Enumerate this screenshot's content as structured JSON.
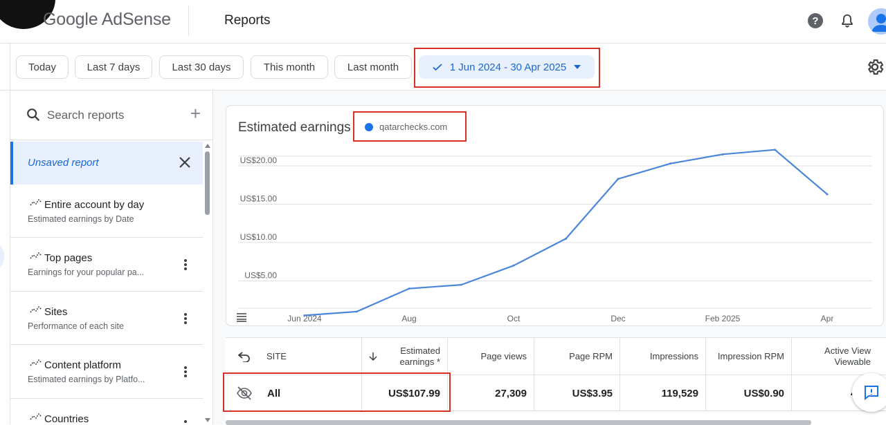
{
  "app": {
    "brand": "Google AdSense",
    "page_title": "Reports"
  },
  "date_filters": [
    {
      "label": "Today"
    },
    {
      "label": "Last 7 days"
    },
    {
      "label": "Last 30 days"
    },
    {
      "label": "This month"
    },
    {
      "label": "Last month"
    },
    {
      "label": "1 Jun 2024 - 30 Apr 2025",
      "selected": true
    }
  ],
  "sidebar": {
    "search_placeholder": "Search reports",
    "items": [
      {
        "title": "Unsaved report",
        "subtitle": "",
        "active": true
      },
      {
        "title": "Entire account by day",
        "subtitle": "Estimated earnings by Date"
      },
      {
        "title": "Top pages",
        "subtitle": "Earnings for your popular pa..."
      },
      {
        "title": "Sites",
        "subtitle": "Performance of each site"
      },
      {
        "title": "Content platform",
        "subtitle": "Estimated earnings by Platfo..."
      },
      {
        "title": "Countries",
        "subtitle": ""
      }
    ]
  },
  "chart_card": {
    "title": "Estimated earnings",
    "legend_label": "qatarchecks.com"
  },
  "chart_data": {
    "type": "line",
    "title": "Estimated earnings",
    "x_tick_labels": [
      "Jun 2024",
      "Aug",
      "Oct",
      "Dec",
      "Feb 2025",
      "Apr"
    ],
    "y_tick_labels": [
      "US$5.00",
      "US$10.00",
      "US$15.00",
      "US$20.00"
    ],
    "ylim": [
      0,
      20
    ],
    "grid": true,
    "series": [
      {
        "name": "qatarchecks.com",
        "color": "#4a86d9",
        "x": [
          "Jun 2024",
          "Jul",
          "Aug",
          "Sep",
          "Oct",
          "Nov",
          "Dec",
          "Jan",
          "Feb 2025",
          "Mar",
          "Apr"
        ],
        "values": [
          0.5,
          1.0,
          4.0,
          4.5,
          7.0,
          10.5,
          18.3,
          20.3,
          21.5,
          22.1,
          16.3
        ]
      }
    ]
  },
  "table": {
    "headers": [
      "SITE",
      "Estimated earnings *",
      "Page views",
      "Page RPM",
      "Impressions",
      "Impression RPM",
      "Active View Viewable"
    ],
    "rows": [
      {
        "site": "All",
        "estimated_earnings": "US$107.99",
        "page_views": "27,309",
        "page_rpm": "US$3.95",
        "impressions": "119,529",
        "impression_rpm": "US$0.90",
        "active_view": "48."
      }
    ]
  },
  "colors": {
    "accent": "#1a73e8",
    "highlight_box": "#d93025",
    "selected_chip_bg": "#e8f0fe"
  }
}
